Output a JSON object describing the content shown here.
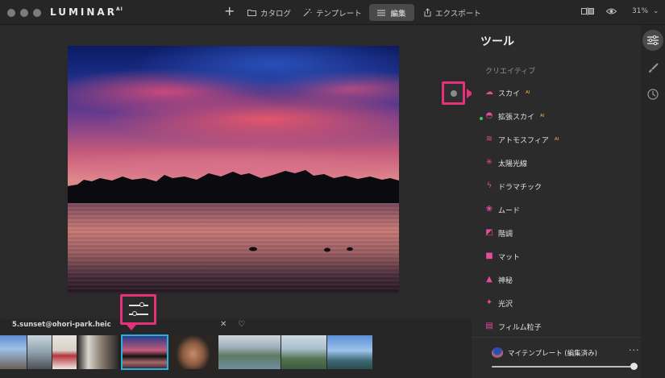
{
  "app": {
    "logo_text": "LUMINAR",
    "logo_sup": "AI"
  },
  "topbar": {
    "add_symbol": "+",
    "catalog_label": "カタログ",
    "templates_label": "テンプレート",
    "edit_label": "編集",
    "export_label": "エクスポート",
    "zoom_label": "31%",
    "zoom_caret": "⌄"
  },
  "canvas": {
    "filename": "5.sunset@ohori-park.heic",
    "close_symbol": "✕",
    "favorite_symbol": "♡"
  },
  "filmstrip": {
    "active_index": 3
  },
  "panel": {
    "title": "ツール",
    "section_label": "クリエイティブ",
    "ai_badge": "AI",
    "tools": [
      {
        "label": "スカイ",
        "ai": true,
        "icon": "cloud-icon"
      },
      {
        "label": "拡張スカイ",
        "ai": true,
        "icon": "dome-icon"
      },
      {
        "label": "アトモスフィア",
        "ai": true,
        "icon": "waves-icon"
      },
      {
        "label": "太陽光線",
        "ai": false,
        "icon": "sun-rays-icon"
      },
      {
        "label": "ドラマチック",
        "ai": false,
        "icon": "bolt-icon"
      },
      {
        "label": "ムード",
        "ai": false,
        "icon": "lotus-icon"
      },
      {
        "label": "階調",
        "ai": false,
        "icon": "bucket-icon"
      },
      {
        "label": "マット",
        "ai": false,
        "icon": "square-icon"
      },
      {
        "label": "神秘",
        "ai": false,
        "icon": "mountain-icon"
      },
      {
        "label": "光沢",
        "ai": false,
        "icon": "sparkle-icon"
      },
      {
        "label": "フィルム粒子",
        "ai": false,
        "icon": "film-icon"
      }
    ],
    "preset": {
      "label": "マイテンプレート (編集済み)",
      "more_symbol": "···",
      "amount": 1.0
    }
  },
  "colors": {
    "accent_pink": "#e6317a",
    "tool_icon_pink": "#e84a9b",
    "selection_blue": "#22b3e3",
    "ai_badge_orange": "#ffb23e"
  }
}
